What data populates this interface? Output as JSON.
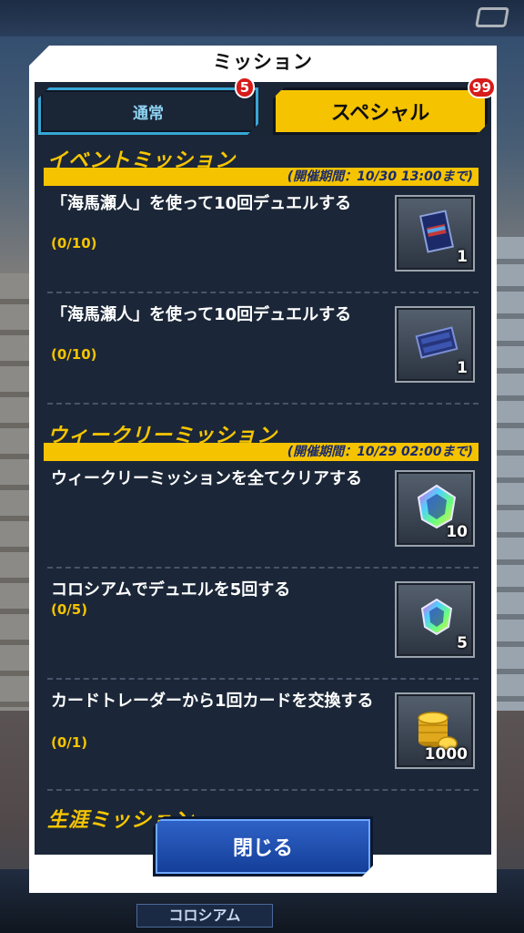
{
  "dialog": {
    "title": "ミッション"
  },
  "tabs": [
    {
      "label": "通常",
      "badge": "5",
      "active": false
    },
    {
      "label": "スペシャル",
      "badge": "99",
      "active": true
    }
  ],
  "sections": [
    {
      "title": "イベントミッション",
      "period": "(開催期間：10/30 13:00まで)",
      "missions": [
        {
          "text": "「海馬瀬人」を使って10回デュエルする",
          "progress": "(0/10)",
          "reward_icon": "card-pack-icon",
          "reward_count": "1"
        },
        {
          "text": "「海馬瀬人」を使って10回デュエルする",
          "progress": "(0/10)",
          "reward_icon": "card-sleeve-icon",
          "reward_count": "1"
        }
      ]
    },
    {
      "title": "ウィークリーミッション",
      "period": "(開催期間：10/29 02:00まで)",
      "missions": [
        {
          "text": "ウィークリーミッションを全てクリアする",
          "progress": "",
          "reward_icon": "gem-icon",
          "reward_count": "10"
        },
        {
          "text": "コロシアムでデュエルを5回する",
          "progress": "(0/5)",
          "reward_icon": "gem-icon",
          "reward_count": "5"
        },
        {
          "text": "カードトレーダーから1回カードを交換する",
          "progress": "(0/1)",
          "reward_icon": "gold-coins-icon",
          "reward_count": "1000"
        }
      ]
    },
    {
      "title": "生涯ミッション"
    }
  ],
  "close_button": {
    "label": "閉じる"
  },
  "background": {
    "nav_label": "コロシアム"
  },
  "colors": {
    "accent_yellow": "#f5c300",
    "panel": "#1b2738",
    "tab_border": "#37a7d6",
    "close_blue": "#2f63c8"
  }
}
